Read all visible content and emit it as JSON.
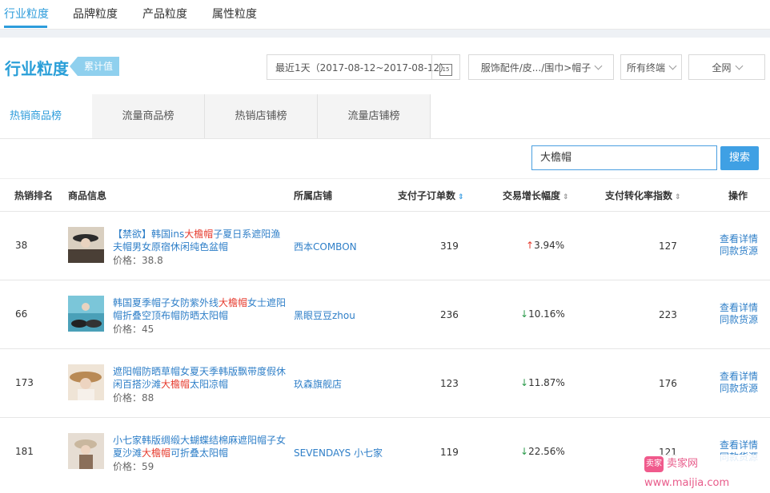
{
  "top_tabs": [
    "行业粒度",
    "品牌粒度",
    "产品粒度",
    "属性粒度"
  ],
  "title": "行业粒度",
  "badge": "累计值",
  "filters": {
    "date_range": "最近1天（2017-08-12~2017-08-12）",
    "calendar_day": "15",
    "category": "服饰配件/皮.../围巾>帽子",
    "terminal": "所有终端",
    "region": "全网"
  },
  "list_tabs": [
    "热销商品榜",
    "流量商品榜",
    "热销店铺榜",
    "流量店铺榜"
  ],
  "search": {
    "value": "大檐帽",
    "button": "搜索"
  },
  "columns": {
    "rank": "热销排名",
    "info": "商品信息",
    "shop": "所属店铺",
    "orders": "支付子订单数",
    "growth": "交易增长幅度",
    "conversion": "支付转化率指数",
    "actions": "操作"
  },
  "rows": [
    {
      "rank": "38",
      "name_parts": [
        "【禁欲】韩国ins",
        "大檐帽",
        "子夏日系遮阳渔夫帽男女原宿休闲纯色盆帽"
      ],
      "price": "价格：38.8",
      "shop": "西本COMBON",
      "orders": "319",
      "growth": "3.94%",
      "growth_dir": "up",
      "conversion": "127",
      "op1": "查看详情",
      "op2": "同款货源"
    },
    {
      "rank": "66",
      "name_parts": [
        "韩国夏季帽子女防紫外线",
        "大檐帽",
        "女士遮阳帽折叠空顶布帽防晒太阳帽"
      ],
      "price": "价格：45",
      "shop": "黑眼豆豆zhou",
      "orders": "236",
      "growth": "10.16%",
      "growth_dir": "down",
      "conversion": "223",
      "op1": "查看详情",
      "op2": "同款货源"
    },
    {
      "rank": "173",
      "name_parts": [
        "遮阳帽防晒草帽女夏天季韩版飘带度假休闲百搭沙滩",
        "大檐帽",
        "太阳凉帽"
      ],
      "price": "价格：88",
      "shop": "玖森旗舰店",
      "orders": "123",
      "growth": "11.87%",
      "growth_dir": "down",
      "conversion": "176",
      "op1": "查看详情",
      "op2": "同款货源"
    },
    {
      "rank": "181",
      "name_parts": [
        "小七家韩版绸缎大蝴蝶结棉麻遮阳帽子女夏沙滩",
        "大檐帽",
        "可折叠太阳帽"
      ],
      "price": "价格：59",
      "shop": "SEVENDAYS 小七家",
      "orders": "119",
      "growth": "22.56%",
      "growth_dir": "down",
      "conversion": "121",
      "op1": "查看详情",
      "op2": "同款货源"
    }
  ],
  "watermark": {
    "logo": "卖家",
    "text": "卖家网 www.maijia.com"
  }
}
